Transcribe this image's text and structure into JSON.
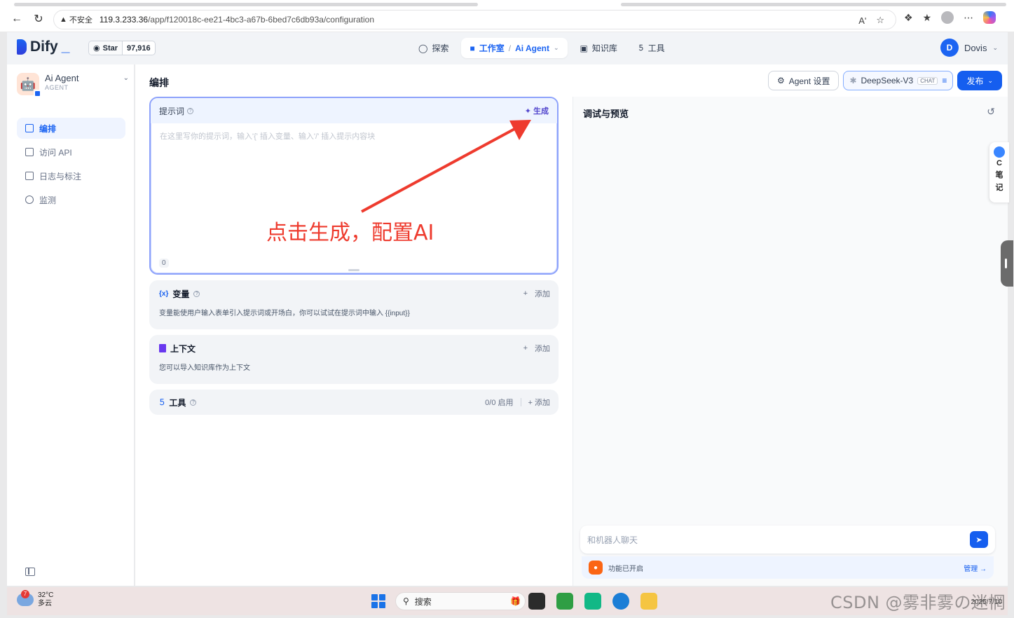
{
  "browser": {
    "security_label": "不安全",
    "url_host": "119.3.233.36",
    "url_path": "/app/f120018c-ee21-4bc3-a67b-6bed7c6db93a/configuration",
    "read_aloud": "Aʹ"
  },
  "header": {
    "logo_text": "Dify",
    "github_label": "Star",
    "github_count": "97,916",
    "nav": {
      "explore": "探索",
      "studio": "工作室",
      "studio_sep": "/",
      "studio_app": "Ai Agent",
      "knowledge": "知识库",
      "tools": "工具"
    },
    "user_initial": "D",
    "user_name": "Dovis"
  },
  "sidebar": {
    "app_name": "Ai Agent",
    "app_mode": "AGENT",
    "items": [
      {
        "label": "编排",
        "active": true
      },
      {
        "label": "访问 API",
        "active": false
      },
      {
        "label": "日志与标注",
        "active": false
      },
      {
        "label": "监测",
        "active": false
      }
    ]
  },
  "main": {
    "title": "编排",
    "agent_settings": "Agent 设置",
    "model_name": "DeepSeek-V3",
    "model_tag": "CHAT",
    "publish": "发布",
    "prompt": {
      "label": "提示词",
      "generate": "生成",
      "placeholder": "在这里写你的提示词，输入'{' 插入变量、输入'/' 插入提示内容块",
      "char_count": "0"
    },
    "variables": {
      "title": "变量",
      "add": "添加",
      "desc": "变量能使用户输入表单引入提示词或开场白，你可以试试在提示词中输入 {{input}}"
    },
    "context": {
      "title": "上下文",
      "add": "添加",
      "desc": "您可以导入知识库作为上下文"
    },
    "tools": {
      "title": "工具",
      "enabled": "0/0 启用",
      "add": "添加"
    }
  },
  "preview": {
    "title": "调试与预览",
    "chat_placeholder": "和机器人聊天",
    "feature_text": "功能已开启",
    "manage": "管理"
  },
  "side_plugin": {
    "c": "C",
    "l1": "笔",
    "l2": "记"
  },
  "annotation": {
    "text": "点击生成，配置AI",
    "color": "#ee3b2e"
  },
  "taskbar": {
    "temp": "32°C",
    "weather": "多云",
    "weather_badge": "7",
    "search": "搜索",
    "date": "2025/7/10"
  },
  "watermark": "CSDN @雾非雾の迷惘"
}
